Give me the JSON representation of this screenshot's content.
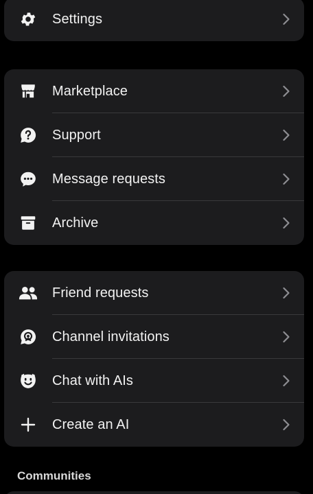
{
  "group_settings": {
    "items": [
      {
        "label": "Settings",
        "icon": "gear-icon"
      }
    ]
  },
  "group_tools": {
    "items": [
      {
        "label": "Marketplace",
        "icon": "storefront-icon"
      },
      {
        "label": "Support",
        "icon": "help-bubble-icon"
      },
      {
        "label": "Message requests",
        "icon": "chat-bubble-icon"
      },
      {
        "label": "Archive",
        "icon": "archive-box-icon"
      }
    ]
  },
  "group_social": {
    "items": [
      {
        "label": "Friend requests",
        "icon": "people-icon"
      },
      {
        "label": "Channel invitations",
        "icon": "channel-icon"
      },
      {
        "label": "Chat with AIs",
        "icon": "ai-face-icon"
      },
      {
        "label": "Create an AI",
        "icon": "plus-icon"
      }
    ]
  },
  "communities": {
    "header": "Communities"
  },
  "colors": {
    "background": "#000000",
    "card": "#1c1c1e",
    "separator": "#3a3a3c",
    "text": "#f2f2f2",
    "chevron": "#8e8e93"
  }
}
